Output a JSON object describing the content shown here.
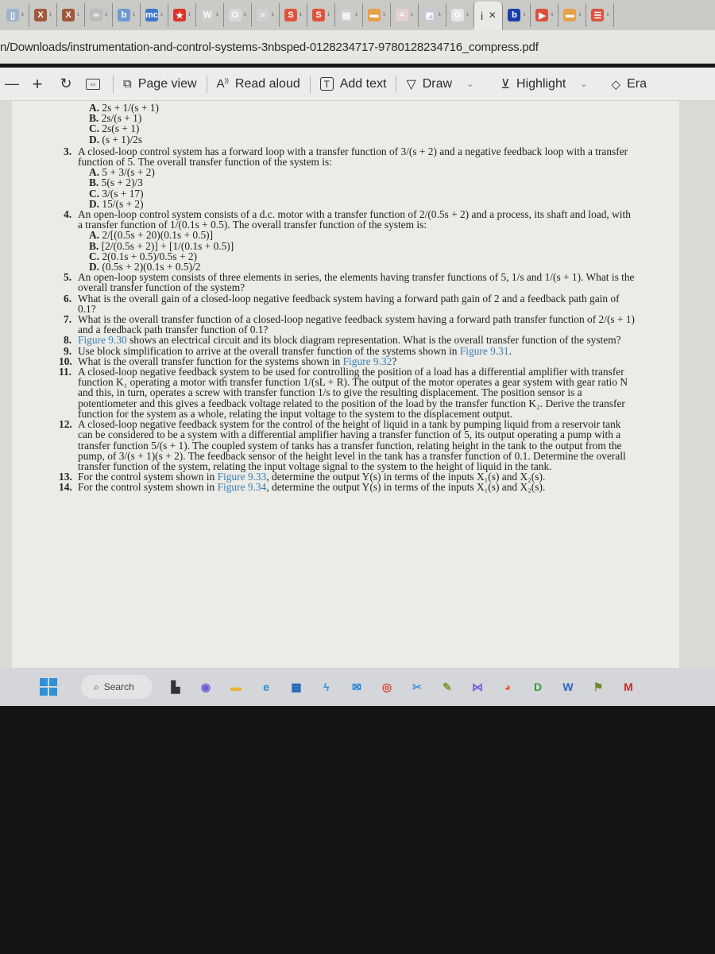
{
  "browser": {
    "tabs": [
      {
        "icon": "generic-page-icon",
        "color": "#9fb4cc",
        "glyph": "▯"
      },
      {
        "icon": "x-brand-icon",
        "color": "#a0593a",
        "glyph": "X"
      },
      {
        "icon": "x-brand-icon",
        "color": "#a0593a",
        "glyph": "X"
      },
      {
        "icon": "link-icon",
        "color": "#bdbdbd",
        "glyph": "∞"
      },
      {
        "icon": "bing-b-icon",
        "color": "#6f9ad2",
        "glyph": "b"
      },
      {
        "icon": "mc-icon",
        "color": "#3d78c8",
        "glyph": "mc"
      },
      {
        "icon": "star-icon",
        "color": "#d9342b",
        "glyph": "★"
      },
      {
        "icon": "wikipedia-icon",
        "color": "#cfcfcf",
        "glyph": "W"
      },
      {
        "icon": "google-icon",
        "color": "#d8d8d8",
        "glyph": "G"
      },
      {
        "icon": "search-icon",
        "color": "#d0d0d0",
        "glyph": "⌕"
      },
      {
        "icon": "s-brand-icon",
        "color": "#e0533b",
        "glyph": "S"
      },
      {
        "icon": "s-brand-icon",
        "color": "#e0533b",
        "glyph": "S"
      },
      {
        "icon": "calendar-icon",
        "color": "#cfcfcf",
        "glyph": "▤"
      },
      {
        "icon": "orange-site-icon",
        "color": "#e8a04a",
        "glyph": "▬"
      },
      {
        "icon": "pdf-icon",
        "color": "#e6d0cf",
        "glyph": "≈"
      },
      {
        "icon": "image-icon",
        "color": "#c4c9d6",
        "glyph": "◩"
      },
      {
        "icon": "google-icon",
        "color": "#e6e6e6",
        "glyph": "G"
      }
    ],
    "active_tab": {
      "icon": "info-icon",
      "glyph": "i",
      "close": "×"
    },
    "right_tabs": [
      {
        "icon": "bing-b-icon",
        "color": "#1b3fa8",
        "glyph": "b"
      },
      {
        "icon": "youtube-icon",
        "color": "#d8523e",
        "glyph": "▶"
      },
      {
        "icon": "orange-site-icon",
        "color": "#e8a04a",
        "glyph": "▬"
      },
      {
        "icon": "red-site-icon",
        "color": "#d8523e",
        "glyph": "☰"
      }
    ],
    "url": "n/Downloads/instrumentation-and-control-systems-3nbsped-0128234717-9780128234716_compress.pdf"
  },
  "pdf_toolbar": {
    "zoom_out": "—",
    "zoom_in": "+",
    "rotate": "↻",
    "fit": "⇔",
    "page_view": "Page view",
    "read_aloud": "Read aloud",
    "add_text": "Add text",
    "draw": "Draw",
    "highlight": "Highlight",
    "erase": "Era"
  },
  "document": {
    "q2_options": [
      {
        "label": "A.",
        "text": "2s + 1/(s + 1)"
      },
      {
        "label": "B.",
        "text": "2s/(s + 1)"
      },
      {
        "label": "C.",
        "text": "2s(s + 1)"
      },
      {
        "label": "D.",
        "text": "(s + 1)/2s"
      }
    ],
    "q3": {
      "num": "3.",
      "text": "A closed-loop control system has a forward loop with a transfer function of 3/(s + 2) and a negative feedback loop with a transfer function of 5. The overall transfer function of the system is:"
    },
    "q3_options": [
      {
        "label": "A.",
        "text": "5 + 3/(s + 2)"
      },
      {
        "label": "B.",
        "text": "5(s + 2)/3"
      },
      {
        "label": "C.",
        "text": "3/(s + 17)"
      },
      {
        "label": "D.",
        "text": "15/(s + 2)"
      }
    ],
    "q4": {
      "num": "4.",
      "text": "An open-loop control system consists of a d.c. motor with a transfer function of 2/(0.5s + 2) and a process, its shaft and load, with a transfer function of 1/(0.1s + 0.5). The overall transfer function of the system is:"
    },
    "q4_options": [
      {
        "label": "A.",
        "text": "2/[(0.5s + 20)(0.1s + 0.5)]"
      },
      {
        "label": "B.",
        "text": "[2/(0.5s + 2)] + [1/(0.1s + 0.5)]"
      },
      {
        "label": "C.",
        "text": "2(0.1s + 0.5)/0.5s + 2)"
      },
      {
        "label": "D.",
        "text": "(0.5s + 2)(0.1s + 0.5)/2"
      }
    ],
    "q5": {
      "num": "5.",
      "text": "An open-loop system consists of three elements in series, the elements having transfer functions of 5, 1/s and 1/(s + 1). What is the overall transfer function of the system?"
    },
    "q6": {
      "num": "6.",
      "text": "What is the overall gain of a closed-loop negative feedback system having a forward path gain of 2 and a feedback path gain of 0.1?"
    },
    "q7": {
      "num": "7.",
      "text": "What is the overall transfer function of a closed-loop negative feedback system having a forward path transfer function of 2/(s + 1) and a feedback path transfer function of 0.1?"
    },
    "q8": {
      "num": "8.",
      "link": "Figure 9.30",
      "text": " shows an electrical circuit and its block diagram representation. What is the overall transfer function of the system?"
    },
    "q9": {
      "num": "9.",
      "text": "Use block simplification to arrive at the overall transfer function of the systems shown in ",
      "link": "Figure 9.31",
      "after": "."
    },
    "q10": {
      "num": "10.",
      "text": "What is the overall transfer function for the systems shown in ",
      "link": "Figure 9.32",
      "after": "?"
    },
    "q11": {
      "num": "11.",
      "text": "A closed-loop negative feedback system to be used for controlling the position of a load has a differential amplifier with transfer function K₁ operating a motor with transfer function 1/(sL + R). The output of the motor operates a gear system with gear ratio N and this, in turn, operates a screw with transfer function 1/s to give the resulting displacement. The position sensor is a potentiometer and this gives a feedback voltage related to the position of the load by the transfer function K₂. Derive the transfer function for the system as a whole, relating the input voltage to the system to the displacement output."
    },
    "q12": {
      "num": "12.",
      "text": "A closed-loop negative feedback system for the control of the height of liquid in a tank by pumping liquid from a reservoir tank can be considered to be a system with a differential amplifier having a transfer function of 5, its output operating a pump with a transfer function 5/(s + 1). The coupled system of tanks has a transfer function, relating height in the tank to the output from the pump, of 3/(s + 1)(s + 2). The feedback sensor of the height level in the tank has a transfer function of 0.1. Determine the overall transfer function of the system, relating the input voltage signal to the system to the height of liquid in the tank."
    },
    "q13": {
      "num": "13.",
      "text": "For the control system shown in ",
      "link": "Figure 9.33",
      "after": ", determine the output Y(s) in terms of the inputs X₁(s) and X₂(s)."
    },
    "q14": {
      "num": "14.",
      "text": "For the control system shown in ",
      "link": "Figure 9.34",
      "after": ", determine the output Y(s) in terms of the inputs X₁(s) and X₂(s)."
    }
  },
  "taskbar": {
    "search_label": "Search",
    "apps": [
      {
        "name": "task-view-icon",
        "glyph": "▙",
        "color": "#333"
      },
      {
        "name": "meet-icon",
        "glyph": "◉",
        "color": "#6a5bd6"
      },
      {
        "name": "file-explorer-icon",
        "glyph": "▬",
        "color": "#e8b53a"
      },
      {
        "name": "edge-icon",
        "glyph": "e",
        "color": "#1c8fd6"
      },
      {
        "name": "store-icon",
        "glyph": "▦",
        "color": "#1f5fb8"
      },
      {
        "name": "power-automate-icon",
        "glyph": "ϟ",
        "color": "#2f8fe0"
      },
      {
        "name": "mail-icon",
        "glyph": "✉",
        "color": "#1c86d8"
      },
      {
        "name": "chrome-icon",
        "glyph": "◎",
        "color": "#d8442f"
      },
      {
        "name": "snipping-tool-icon",
        "glyph": "✂",
        "color": "#4c8fd8"
      },
      {
        "name": "idle-python-icon",
        "glyph": "✎",
        "color": "#7a9a2c"
      },
      {
        "name": "visual-studio-icon",
        "glyph": "⋈",
        "color": "#7c5dd6"
      },
      {
        "name": "firefox-icon",
        "glyph": "◕",
        "color": "#e8622a"
      },
      {
        "name": "dev-app-icon",
        "glyph": "D",
        "color": "#3a9a3a"
      },
      {
        "name": "word-icon",
        "glyph": "W",
        "color": "#2b64c8"
      },
      {
        "name": "tool-app-icon",
        "glyph": "⚑",
        "color": "#6a8a2a"
      },
      {
        "name": "mcafee-icon",
        "glyph": "M",
        "color": "#c8282c"
      }
    ]
  }
}
